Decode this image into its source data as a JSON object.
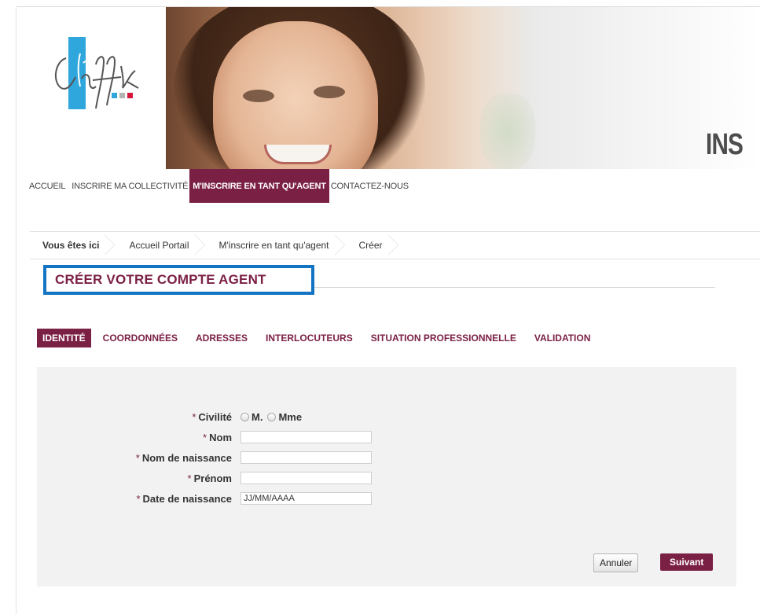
{
  "banner": {
    "title_partial": "INS",
    "logo_text": "le cnfpt"
  },
  "topnav": {
    "items": [
      {
        "label": "ACCUEIL"
      },
      {
        "label": "INSCRIRE MA COLLECTIVITÉ"
      },
      {
        "label": "M'INSCRIRE EN TANT QU'AGENT",
        "active": true
      },
      {
        "label": "CONTACTEZ-NOUS"
      }
    ]
  },
  "breadcrumb": {
    "items": [
      {
        "label": "Vous êtes ici"
      },
      {
        "label": "Accueil Portail"
      },
      {
        "label": "M'inscrire en tant qu'agent"
      },
      {
        "label": "Créer"
      }
    ]
  },
  "page": {
    "title": "CRÉER VOTRE COMPTE AGENT"
  },
  "tabs": [
    {
      "label": "IDENTITÉ",
      "active": true
    },
    {
      "label": "COORDONNÉES"
    },
    {
      "label": "ADRESSES"
    },
    {
      "label": "INTERLOCUTEURS"
    },
    {
      "label": "SITUATION PROFESSIONNELLE"
    },
    {
      "label": "VALIDATION"
    }
  ],
  "form": {
    "required_mark": "*",
    "civilite": {
      "label": "Civilité",
      "options": [
        "M.",
        "Mme"
      ]
    },
    "nom": {
      "label": "Nom",
      "value": ""
    },
    "nom_naissance": {
      "label": "Nom de naissance",
      "value": ""
    },
    "prenom": {
      "label": "Prénom",
      "value": ""
    },
    "date_naissance": {
      "label": "Date de naissance",
      "value": "JJ/MM/AAAA"
    }
  },
  "buttons": {
    "cancel": "Annuler",
    "next": "Suivant"
  },
  "colors": {
    "brand": "#7b2045",
    "highlight_border": "#1474c4",
    "logo_blue": "#2fa6dc"
  }
}
